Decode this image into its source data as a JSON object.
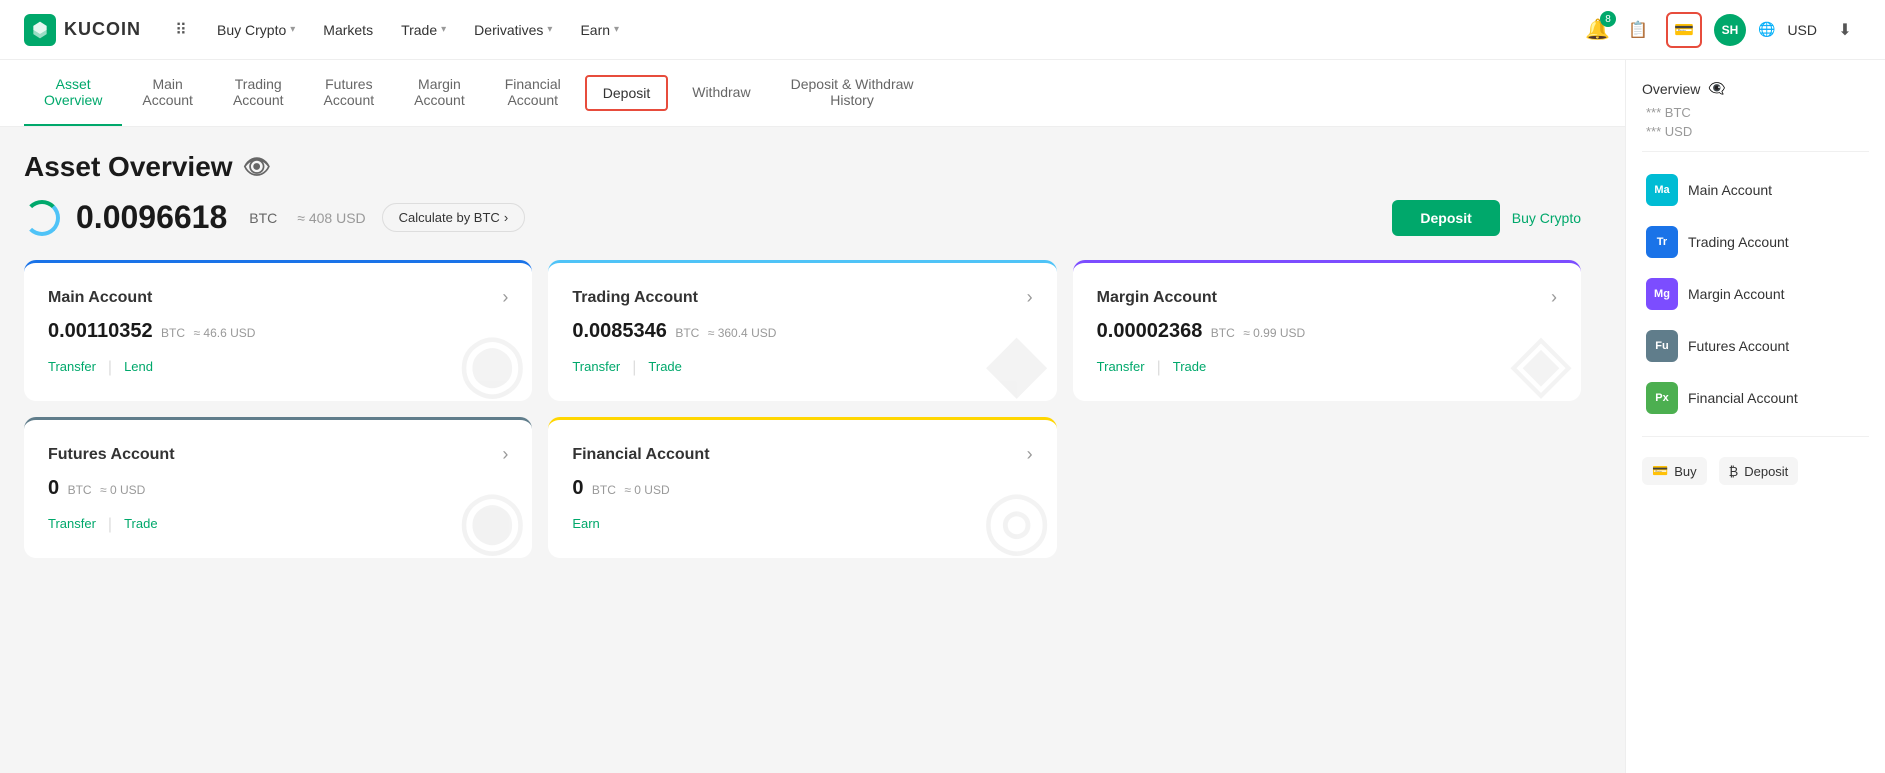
{
  "header": {
    "logo_text": "KUCOIN",
    "nav_items": [
      {
        "label": "Buy Crypto",
        "has_arrow": true
      },
      {
        "label": "Markets",
        "has_arrow": false
      },
      {
        "label": "Trade",
        "has_arrow": true
      },
      {
        "label": "Derivatives",
        "has_arrow": true
      },
      {
        "label": "Earn",
        "has_arrow": true
      }
    ],
    "notif_count": "8",
    "avatar_initials": "SH",
    "currency": "USD"
  },
  "subnav": {
    "items": [
      {
        "label": "Asset\nOverview",
        "active": true,
        "highlighted": false
      },
      {
        "label": "Main\nAccount",
        "active": false,
        "highlighted": false
      },
      {
        "label": "Trading\nAccount",
        "active": false,
        "highlighted": false
      },
      {
        "label": "Futures\nAccount",
        "active": false,
        "highlighted": false
      },
      {
        "label": "Margin\nAccount",
        "active": false,
        "highlighted": false
      },
      {
        "label": "Financial\nAccount",
        "active": false,
        "highlighted": false
      },
      {
        "label": "Deposit",
        "active": false,
        "highlighted": true
      },
      {
        "label": "Withdraw",
        "active": false,
        "highlighted": false
      },
      {
        "label": "Deposit & Withdraw\nHistory",
        "active": false,
        "highlighted": false
      }
    ]
  },
  "asset_overview": {
    "title": "Asset Overview",
    "balance_btc": "0.0096618",
    "balance_btc_unit": "BTC",
    "balance_usd": "≈ 408 USD",
    "calc_btn_label": "Calculate by BTC",
    "deposit_btn": "Deposit",
    "buy_crypto_btn": "Buy Crypto"
  },
  "cards": [
    {
      "id": "main",
      "title": "Main Account",
      "amount": "0.00110352",
      "btc_unit": "BTC",
      "usd": "≈ 46.6 USD",
      "actions": [
        "Transfer",
        "Lend"
      ],
      "color_class": "main-card",
      "watermark": "●"
    },
    {
      "id": "trading",
      "title": "Trading Account",
      "amount": "0.0085346",
      "btc_unit": "BTC",
      "usd": "≈ 360.4 USD",
      "actions": [
        "Transfer",
        "Trade"
      ],
      "color_class": "trading-card",
      "watermark": "◆"
    },
    {
      "id": "margin",
      "title": "Margin Account",
      "amount": "0.00002368",
      "btc_unit": "BTC",
      "usd": "≈ 0.99 USD",
      "actions": [
        "Transfer",
        "Trade"
      ],
      "color_class": "margin-card",
      "watermark": "◈"
    },
    {
      "id": "futures",
      "title": "Futures Account",
      "amount": "0",
      "btc_unit": "BTC",
      "usd": "≈ 0 USD",
      "actions": [
        "Transfer",
        "Trade"
      ],
      "color_class": "futures-card",
      "watermark": "◉"
    },
    {
      "id": "financial",
      "title": "Financial Account",
      "amount": "0",
      "btc_unit": "BTC",
      "usd": "≈ 0 USD",
      "actions": [
        "Earn"
      ],
      "color_class": "financial-card",
      "watermark": "◎"
    }
  ],
  "sidebar": {
    "overview_label": "Overview",
    "balance_btc": "*** BTC",
    "balance_usd": "*** USD",
    "accounts": [
      {
        "label": "Main Account",
        "abbr": "Ma",
        "class": "ma"
      },
      {
        "label": "Trading Account",
        "abbr": "Tr",
        "class": "tr"
      },
      {
        "label": "Margin Account",
        "abbr": "Mg",
        "class": "mg"
      },
      {
        "label": "Futures Account",
        "abbr": "Fu",
        "class": "fu"
      },
      {
        "label": "Financial Account",
        "abbr": "Px",
        "class": "px"
      }
    ],
    "buy_label": "Buy",
    "deposit_label": "Deposit"
  }
}
